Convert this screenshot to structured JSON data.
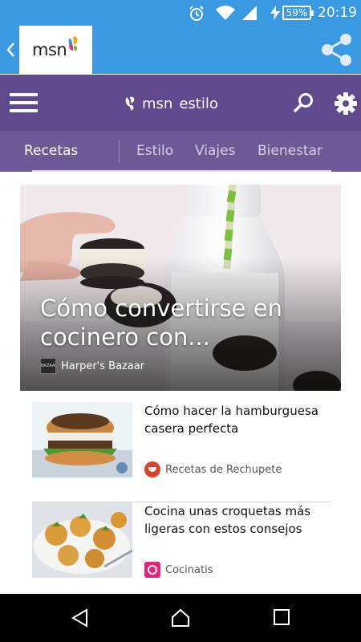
{
  "status_bar": {
    "battery_text": "59%",
    "time": "20:19"
  },
  "app_bar": {
    "logo_text": "msn"
  },
  "header": {
    "brand_msn": "msn",
    "brand_section": "estilo"
  },
  "tabs": [
    {
      "label": "Recetas",
      "active": true
    },
    {
      "label": "Estilo",
      "active": false
    },
    {
      "label": "Viajes",
      "active": false
    },
    {
      "label": "Bienestar",
      "active": false
    }
  ],
  "hero": {
    "title": "Cómo convertirse en cocinero con...",
    "source": "Harper's Bazaar",
    "source_logo_text": "BAZAAR"
  },
  "articles": [
    {
      "title": "Cómo hacer la hamburguesa casera perfecta",
      "source": "Recetas de Rechupete"
    },
    {
      "title": "Cocina unas croquetas más ligeras con estos consejos",
      "source": "Cocinatis"
    }
  ],
  "colors": {
    "status_blue": "#3a99e0",
    "header_purple": "#5f4a8e",
    "tabs_purple": "#6c5996"
  }
}
